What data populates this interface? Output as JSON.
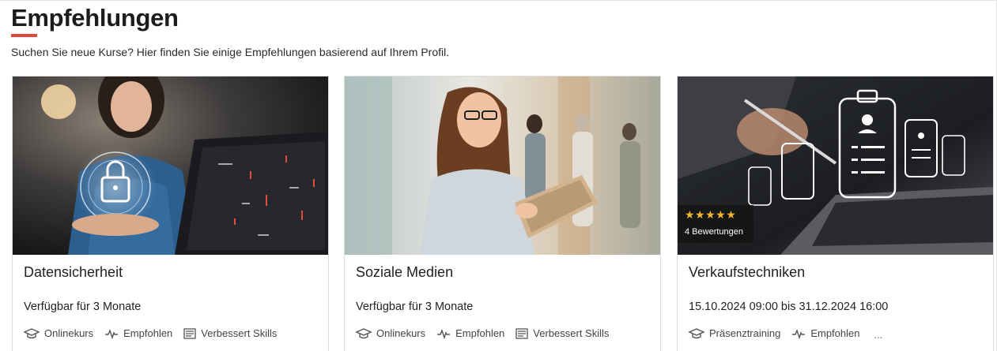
{
  "section": {
    "title": "Empfehlungen",
    "subtitle": "Suchen Sie neue Kurse? Hier finden Sie einige Empfehlungen basierend auf Ihrem Profil.",
    "accent_color": "#e5483a"
  },
  "cards": [
    {
      "title": "Datensicherheit",
      "availability": "Verfügbar für 3 Monate",
      "image": "woman-holding-padlock-hologram-laptop",
      "tags": [
        {
          "icon": "graduation-cap-icon",
          "label": "Onlinekurs"
        },
        {
          "icon": "pulse-icon",
          "label": "Empfohlen"
        },
        {
          "icon": "document-icon",
          "label": "Verbessert Skills"
        }
      ]
    },
    {
      "title": "Soziale Medien",
      "availability": "Verfügbar für 3 Monate",
      "image": "woman-with-tablet-office",
      "tags": [
        {
          "icon": "graduation-cap-icon",
          "label": "Onlinekurs"
        },
        {
          "icon": "pulse-icon",
          "label": "Empfohlen"
        },
        {
          "icon": "document-icon",
          "label": "Verbessert Skills"
        }
      ]
    },
    {
      "title": "Verkaufstechniken",
      "availability": "15.10.2024 09:00 bis 31.12.2024 16:00",
      "image": "hand-with-pen-clipboard-hologram-laptop",
      "rating": {
        "stars": "★★★★★",
        "count_label": "4 Bewertungen",
        "value": 5
      },
      "tags": [
        {
          "icon": "graduation-cap-icon",
          "label": "Präsenztraining"
        },
        {
          "icon": "pulse-icon",
          "label": "Empfohlen"
        }
      ],
      "more_label": "..."
    }
  ]
}
